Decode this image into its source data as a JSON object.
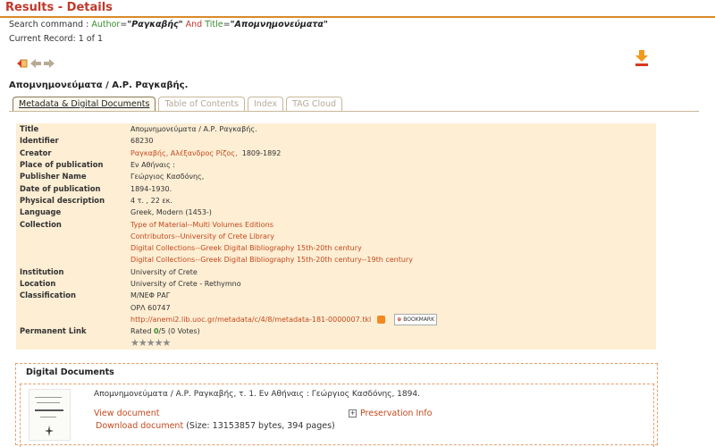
{
  "page": {
    "title": "Results - Details"
  },
  "search": {
    "prefix": "Search command :",
    "author_field": "Author",
    "author_value": "\"Ραγκαβής\"",
    "conjunction": "And",
    "title_field": "Title",
    "title_value": "\"Απομνημονεύματα\""
  },
  "current_record": "Current Record: 1 of 1",
  "record_title": "Απομνημονεύματα / Α.Ρ. Ραγκαβής.",
  "tabs": [
    {
      "label": "Metadata & Digital Documents",
      "active": true
    },
    {
      "label": "Table of Contents",
      "active": false
    },
    {
      "label": "Index",
      "active": false
    },
    {
      "label": "TAG Cloud",
      "active": false
    }
  ],
  "metadata": {
    "title_label": "Title",
    "title": "Απομνημονεύματα / Α.Ρ. Ραγκαβής.",
    "identifier_label": "Identifier",
    "identifier": "68230",
    "creator_label": "Creator",
    "creator_link": "Ραγκαβής, Αλέξανδρος Ρίζος,",
    "creator_years": "1809-1892",
    "place_label": "Place of publication",
    "place": "Εν Αθήναις :",
    "publisher_label": "Publisher Name",
    "publisher": "Γεώργιος Κασδόνης,",
    "date_label": "Date of publication",
    "date": "1894-1930.",
    "physical_label": "Physical description",
    "physical": "4 τ. , 22 εκ.",
    "language_label": "Language",
    "language": "Greek, Modern (1453-)",
    "collection_label": "Collection",
    "collections": [
      "Type of Material--Multi Volumes Editions",
      "Contributors--University of Crete Library",
      "Digital Collections--Greek Digital Bibliography 15th-20th century",
      "Digital Collections--Greek Digital Bibliography 15th-20th century--19th century"
    ],
    "institution_label": "Institution",
    "institution": "University of Crete",
    "location_label": "Location",
    "location": "University of Crete - Rethymno",
    "classification_label": "Classification",
    "classification_1": "Μ/ΝΕΦ ΡΑΓ",
    "classification_2": "ΟΡΛ 60747",
    "permalink_label": "Permanent Link",
    "permalink": "http://anemi2.lib.uoc.gr/metadata/c/4/8/metadata-181-0000007.tkl",
    "bookmark_label": "BOOKMARK",
    "rated_prefix": "Rated ",
    "rated_value": "0",
    "rated_suffix": "/5 (0 Votes)",
    "rating_stars": 0
  },
  "digital_documents": {
    "heading": "Digital Documents",
    "description": "Απομνημονεύματα / Α.Ρ. Ραγκαβής, τ. 1. Εν Αθήναις : Γεώργιος Κασδόνης, 1894.",
    "view_label": "View document",
    "preservation_label": "Preservation Info",
    "download_label": "Download document",
    "download_info": "(Size: 13153857 bytes, 394 pages)",
    "thumb_title": "ΑΠΟΜΝΗΜΟΝΕΥΜΑΤΑ"
  },
  "colors": {
    "accent": "#d98a2b",
    "title_red": "#c0392b",
    "link": "#c44a1e",
    "table_bg": "#fdeed4",
    "green": "#3a8a2e"
  }
}
